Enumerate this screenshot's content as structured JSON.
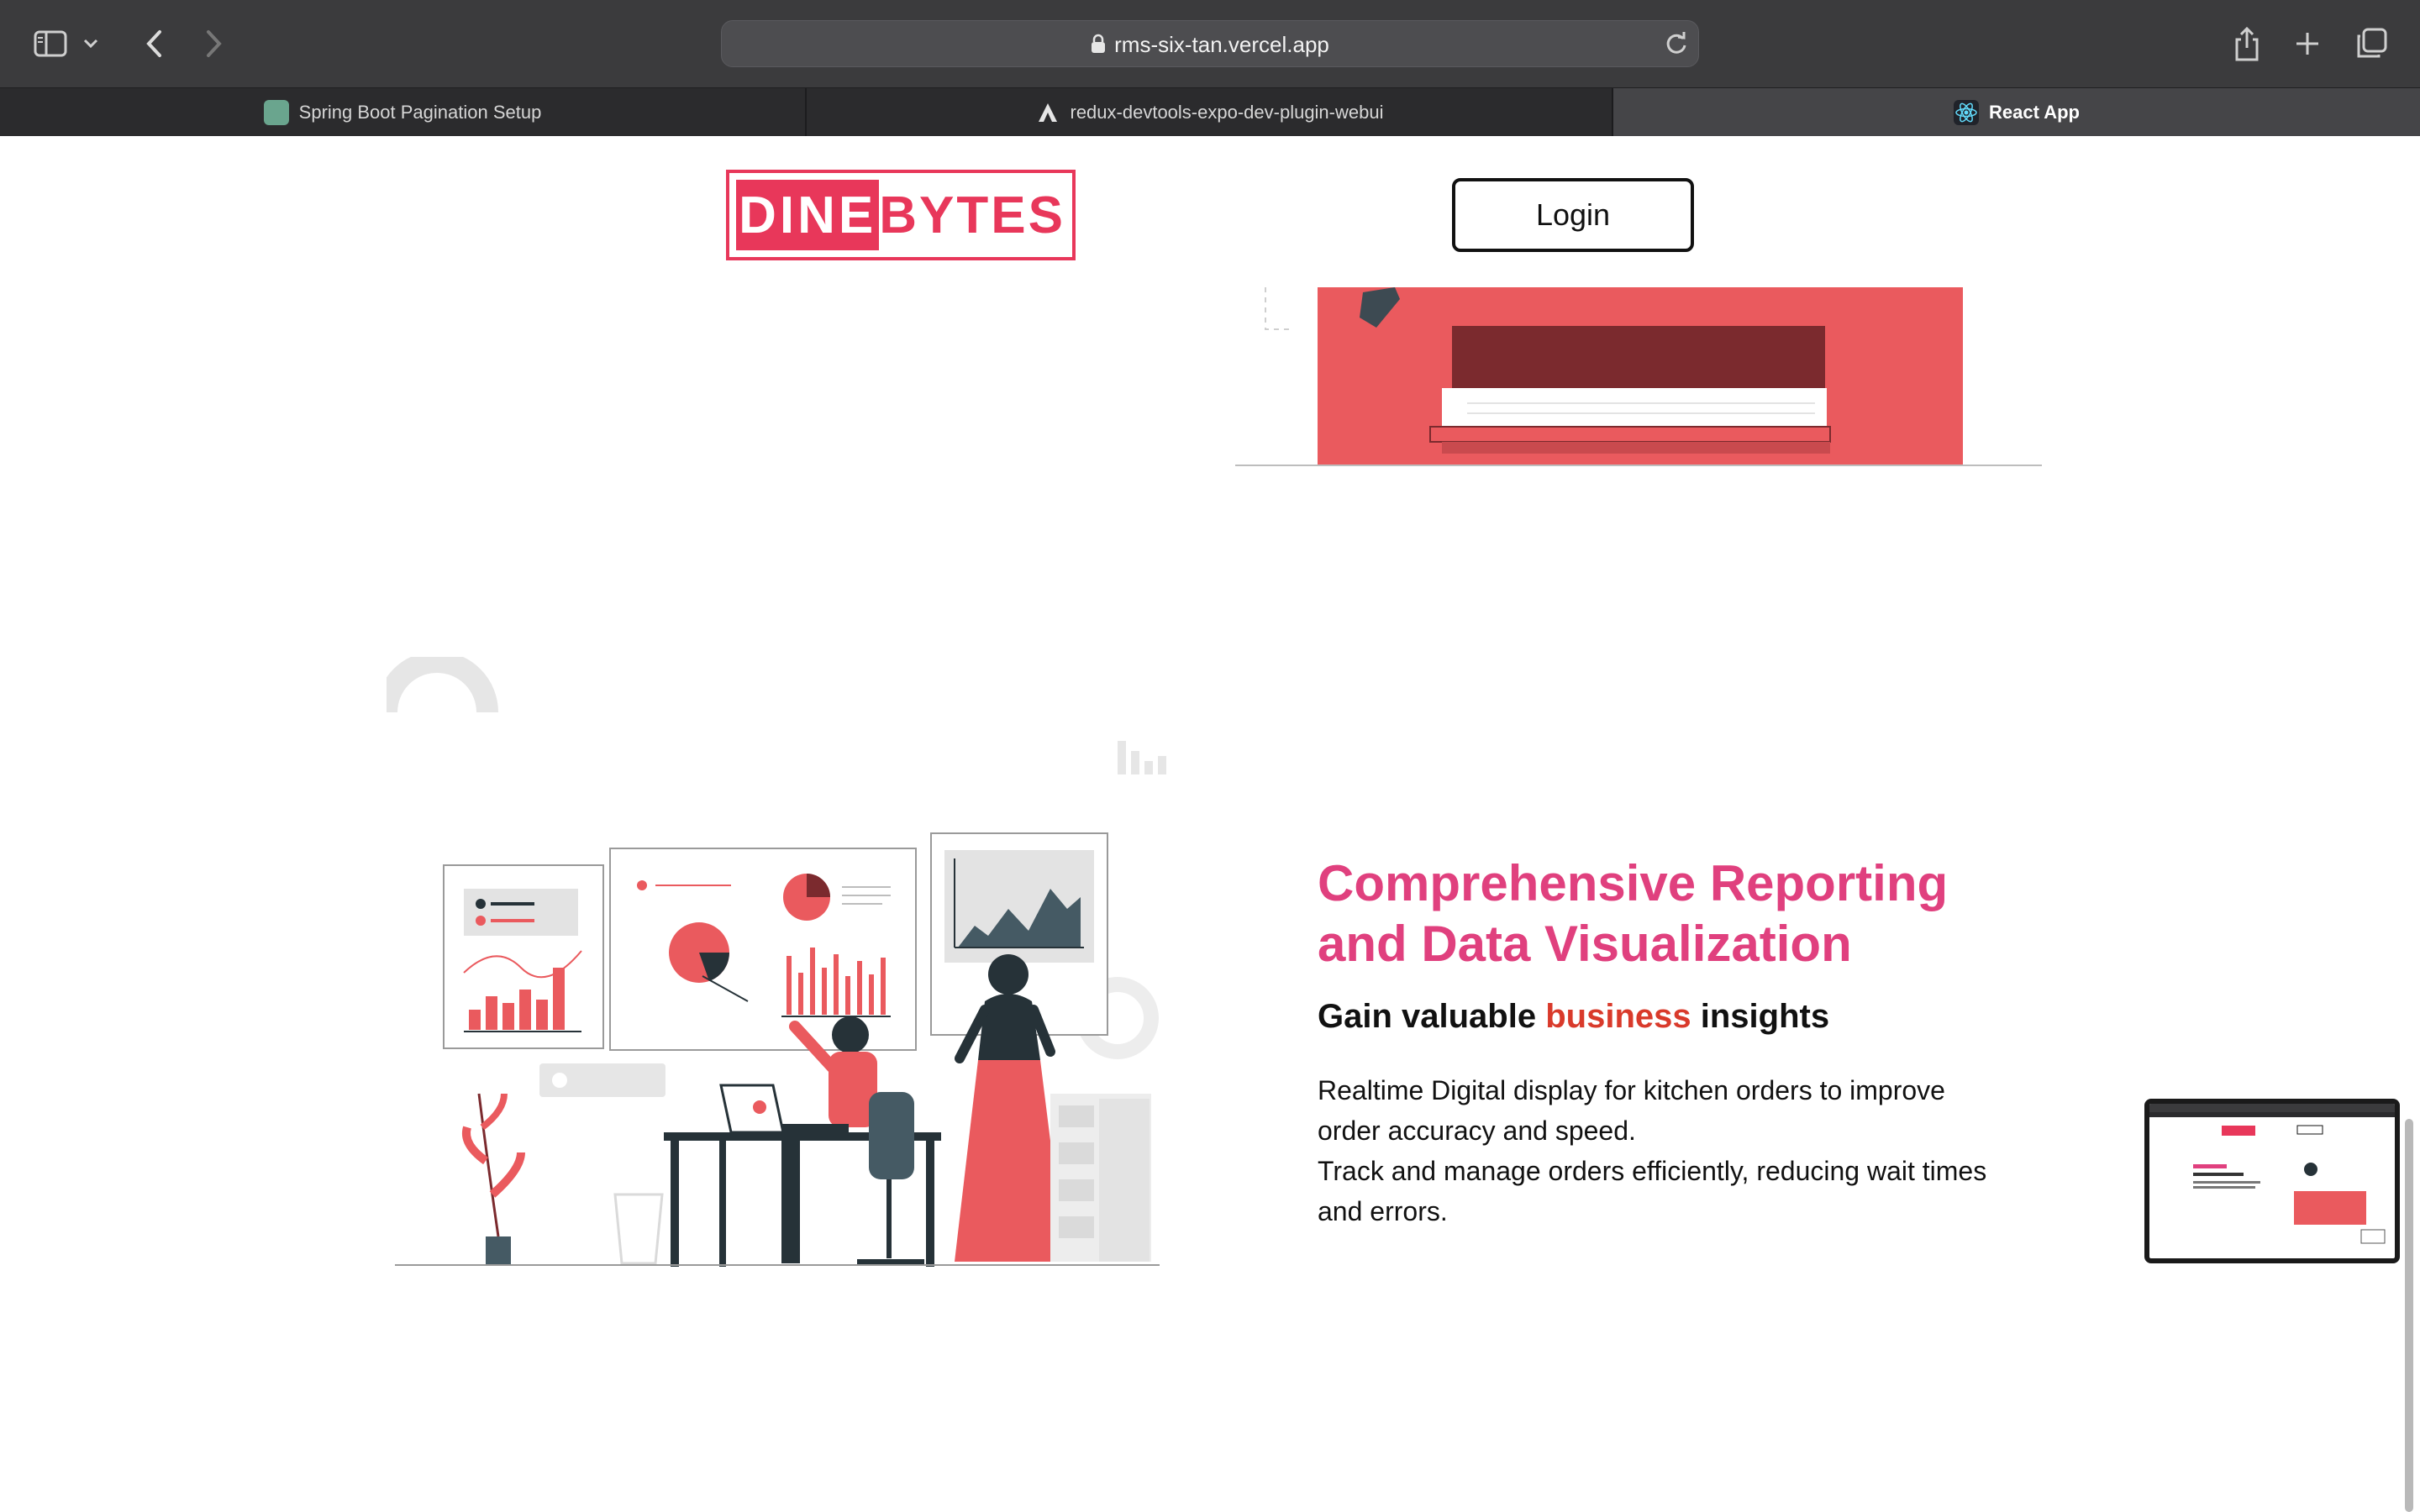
{
  "browser": {
    "url": "rms-six-tan.vercel.app",
    "tabs": [
      {
        "label": "Spring Boot Pagination Setup",
        "active": false
      },
      {
        "label": "redux-devtools-expo-dev-plugin-webui",
        "active": false
      },
      {
        "label": "React App",
        "active": true
      }
    ]
  },
  "header": {
    "logo_part1": "DINE",
    "logo_part2": "BYTES",
    "login_label": "Login"
  },
  "feature": {
    "title_line1": "Comprehensive Reporting",
    "title_line2": "and Data Visualization",
    "subtitle_pre": "Gain valuable ",
    "subtitle_highlight": "business",
    "subtitle_post": " insights",
    "desc_line1": "Realtime Digital display for kitchen orders to improve order accuracy and speed.",
    "desc_line2": "Track and manage orders efficiently, reducing wait times and errors."
  },
  "colors": {
    "brand": "#e8375a",
    "title": "#e0407e",
    "highlight": "#d93a2b",
    "illustration_red": "#ea5a5e"
  }
}
